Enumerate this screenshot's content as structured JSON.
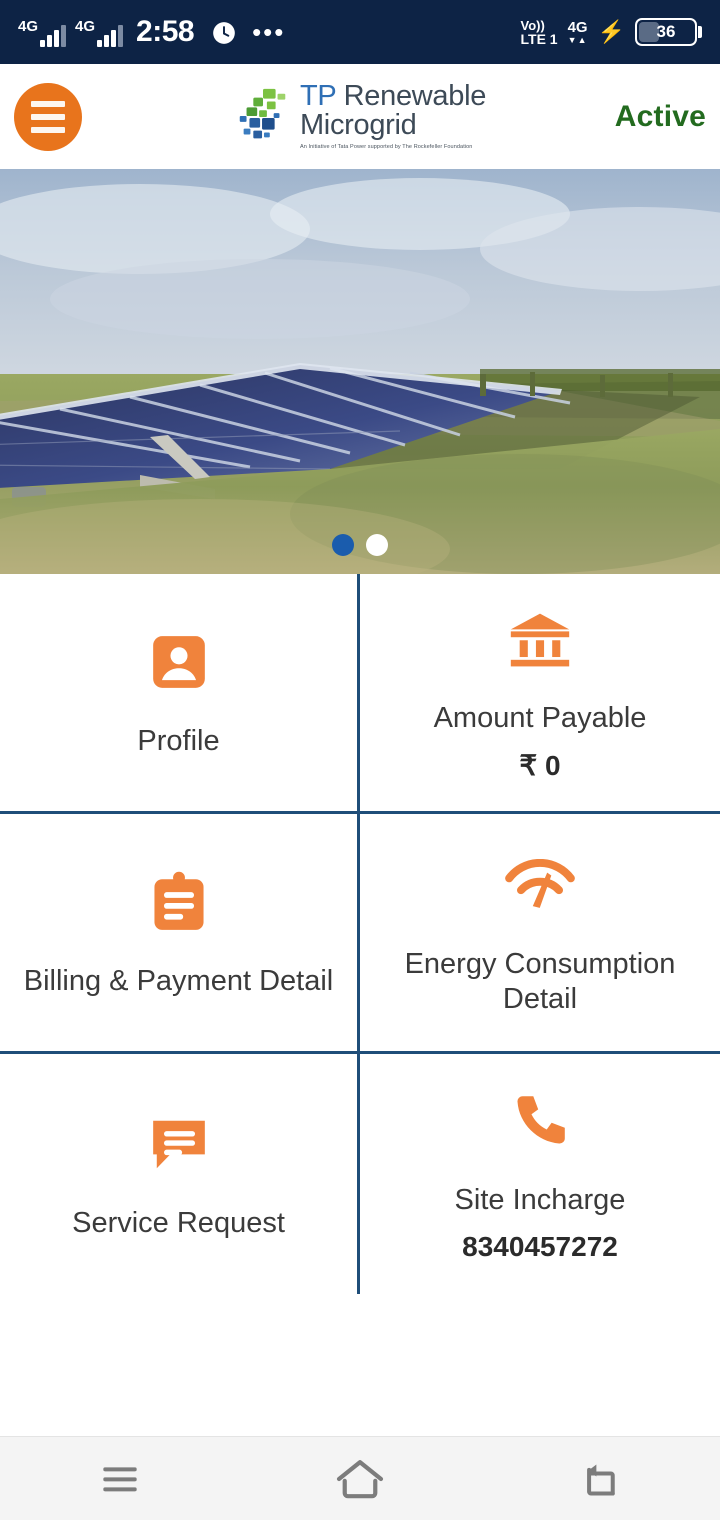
{
  "status_bar": {
    "network_labels": [
      "4G",
      "4G"
    ],
    "time": "2:58",
    "alarm_icon": "alarm-icon",
    "overflow": "•••",
    "volte_line1": "Vo))",
    "volte_line2": "LTE 1",
    "data_label": "4G",
    "data_arrows": "▼▲",
    "charging_icon": "charging-bolt-icon",
    "battery_level": "36"
  },
  "header": {
    "menu_label": "menu",
    "brand_line1_prefix": "TP",
    "brand_line1": " Renewable",
    "brand_line2": "Microgrid",
    "brand_tagline": "An Initiative of Tata Power supported by The Rockefeller Foundation",
    "status": "Active",
    "status_color": "#236b1f",
    "accent_color": "#e8741c"
  },
  "carousel": {
    "alt": "Solar panel array in a grass field under cloudy sky",
    "slide_count": 2,
    "active_index": 0,
    "active_dot_color": "#1a5cad",
    "inactive_dot_color": "#ffffff"
  },
  "grid": {
    "divider_color": "#1f4e79",
    "tiles": [
      {
        "icon": "profile-icon",
        "label": "Profile",
        "value": ""
      },
      {
        "icon": "bank-icon",
        "label": "Amount Payable",
        "value": "₹ 0"
      },
      {
        "icon": "clipboard-icon",
        "label": "Billing & Payment Detail",
        "value": ""
      },
      {
        "icon": "gauge-icon",
        "label": "Energy Consumption Detail",
        "value": ""
      },
      {
        "icon": "chat-icon",
        "label": "Service Request",
        "value": ""
      },
      {
        "icon": "phone-icon",
        "label": "Site Incharge",
        "value": "8340457272"
      }
    ]
  },
  "nav_bar": {
    "recents_label": "recents",
    "home_label": "home",
    "back_label": "back"
  }
}
